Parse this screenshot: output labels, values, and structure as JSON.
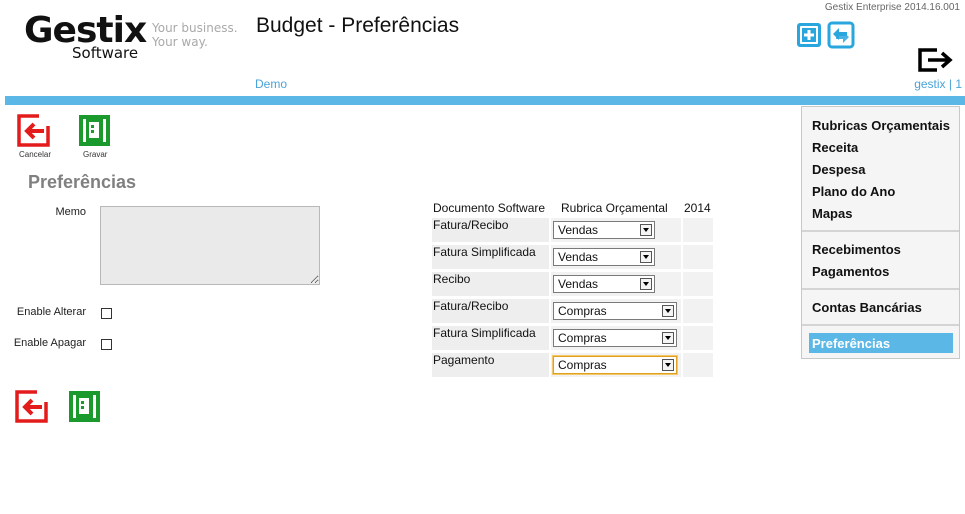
{
  "header": {
    "logo_main": "Gestix",
    "logo_sub": "Software",
    "slogan_line1": "Your business.",
    "slogan_line2": "Your way.",
    "title": "Budget - Preferências",
    "version": "Gestix Enterprise 2014.16.001",
    "company": "Demo",
    "user": "gestix | 1",
    "accent_color": "#5bb8e6"
  },
  "toolbar": {
    "cancel_label": "Cancelar",
    "save_label": "Gravar"
  },
  "form": {
    "title": "Preferências",
    "memo_label": "Memo",
    "memo_value": "",
    "enable_alterar_label": "Enable Alterar",
    "enable_alterar_checked": false,
    "enable_apagar_label": "Enable Apagar",
    "enable_apagar_checked": false
  },
  "table": {
    "headers": [
      "Documento Software",
      "Rubrica Orçamental",
      "2014"
    ],
    "rows": [
      {
        "documento": "Fatura/Recibo",
        "rubrica": "Vendas"
      },
      {
        "documento": "Fatura Simplificada",
        "rubrica": "Vendas"
      },
      {
        "documento": "Recibo",
        "rubrica": "Vendas"
      },
      {
        "documento": "Fatura/Recibo",
        "rubrica": "Compras"
      },
      {
        "documento": "Fatura Simplificada",
        "rubrica": "Compras"
      },
      {
        "documento": "Pagamento",
        "rubrica": "Compras"
      }
    ]
  },
  "menu": {
    "items": [
      "Rubricas Orçamentais",
      "Receita",
      "Despesa",
      "Plano do Ano",
      "Mapas",
      "Recebimentos",
      "Pagamentos",
      "Contas Bancárias",
      "Preferências"
    ],
    "active": "Preferências"
  },
  "icons": {
    "new": "plus-square-icon",
    "refresh": "refresh-icon",
    "logout": "logout-icon",
    "cancel": "cancel-arrow-icon",
    "save": "save-door-icon"
  }
}
